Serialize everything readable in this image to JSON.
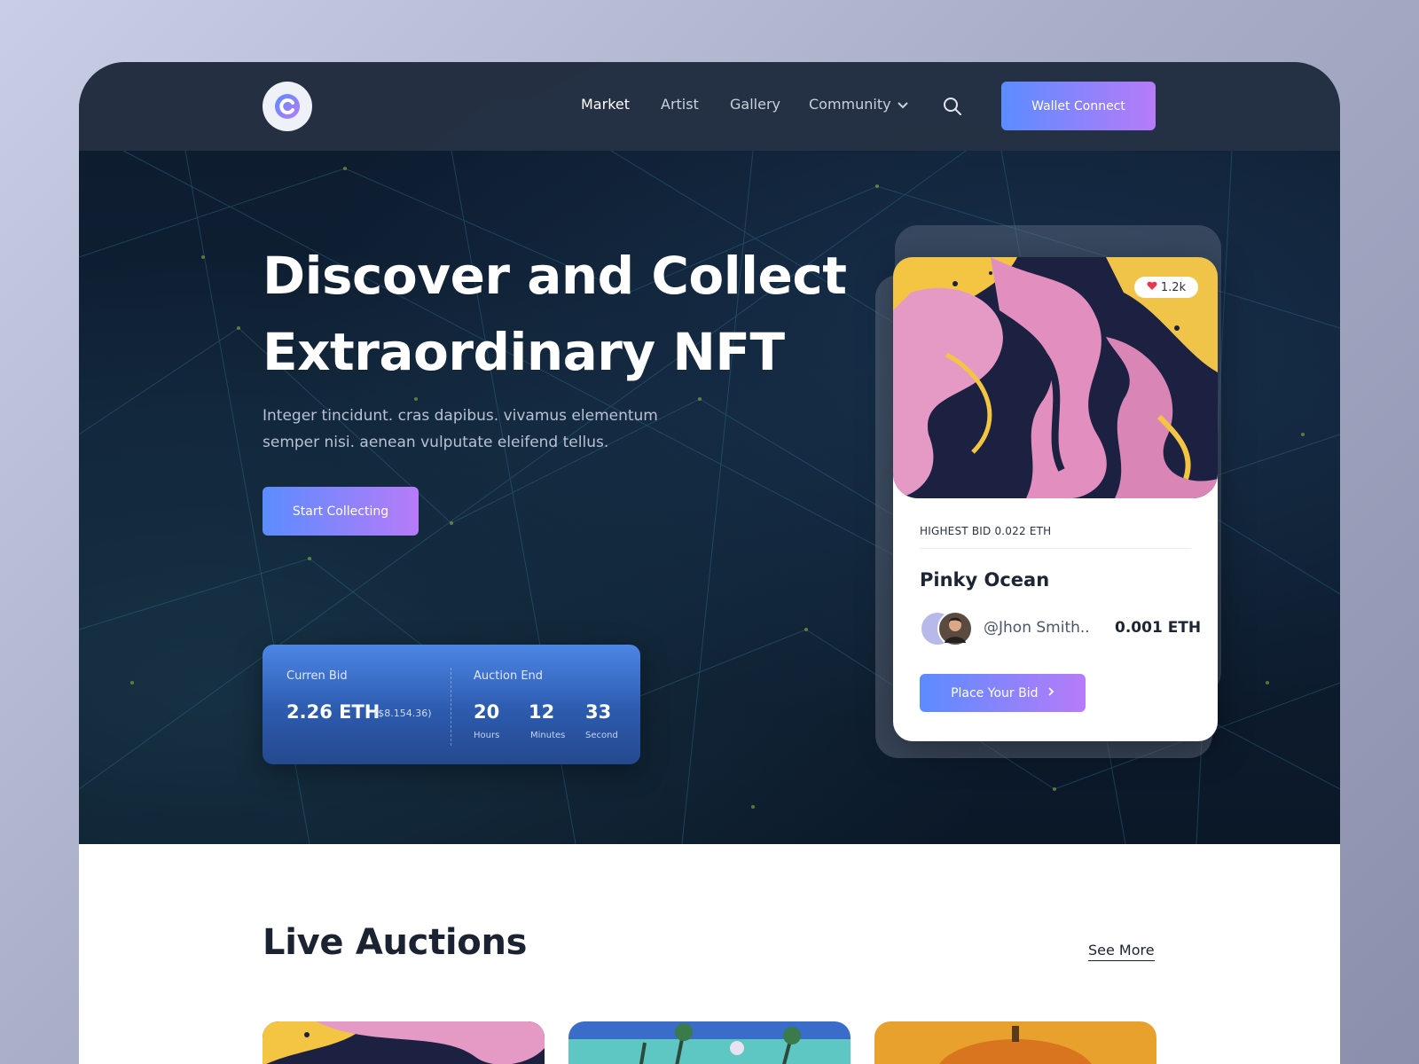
{
  "nav": {
    "links": [
      {
        "label": "Market",
        "active": true
      },
      {
        "label": "Artist",
        "active": false
      },
      {
        "label": "Gallery",
        "active": false
      },
      {
        "label": "Community",
        "active": false
      }
    ],
    "wallet_label": "Wallet Connect"
  },
  "hero": {
    "title_line1": "Discover and Collect",
    "title_line2": "Extraordinary NFT",
    "description": "Integer tincidunt. cras dapibus. vivamus elementum semper nisi. aenean vulputate eleifend tellus.",
    "cta_label": "Start Collecting"
  },
  "bid_panel": {
    "current_label": "Curren Bid",
    "current_eth": "2.26 ETH",
    "current_usd": "($8.154.36)",
    "auction_label": "Auction End",
    "countdown": [
      {
        "value": "20",
        "unit": "Hours"
      },
      {
        "value": "12",
        "unit": "Minutes"
      },
      {
        "value": "33",
        "unit": "Second"
      }
    ]
  },
  "featured_card": {
    "likes": "1.2k",
    "highest_bid": "HIGHEST BID 0.022 ETH",
    "title": "Pinky Ocean",
    "user": "@Jhon Smith..",
    "price": "0.001 ETH",
    "bid_label": "Place Your Bid"
  },
  "live_auctions": {
    "title": "Live Auctions",
    "see_more": "See More"
  },
  "colors": {
    "accent_start": "#5b8cff",
    "accent_end": "#b77bf8",
    "hero_bg": "#0d1b2e",
    "like_heart": "#e53950"
  },
  "icons": [
    "logo-icon",
    "chevron-down-icon",
    "search-icon",
    "heart-icon",
    "chevron-right-icon"
  ]
}
